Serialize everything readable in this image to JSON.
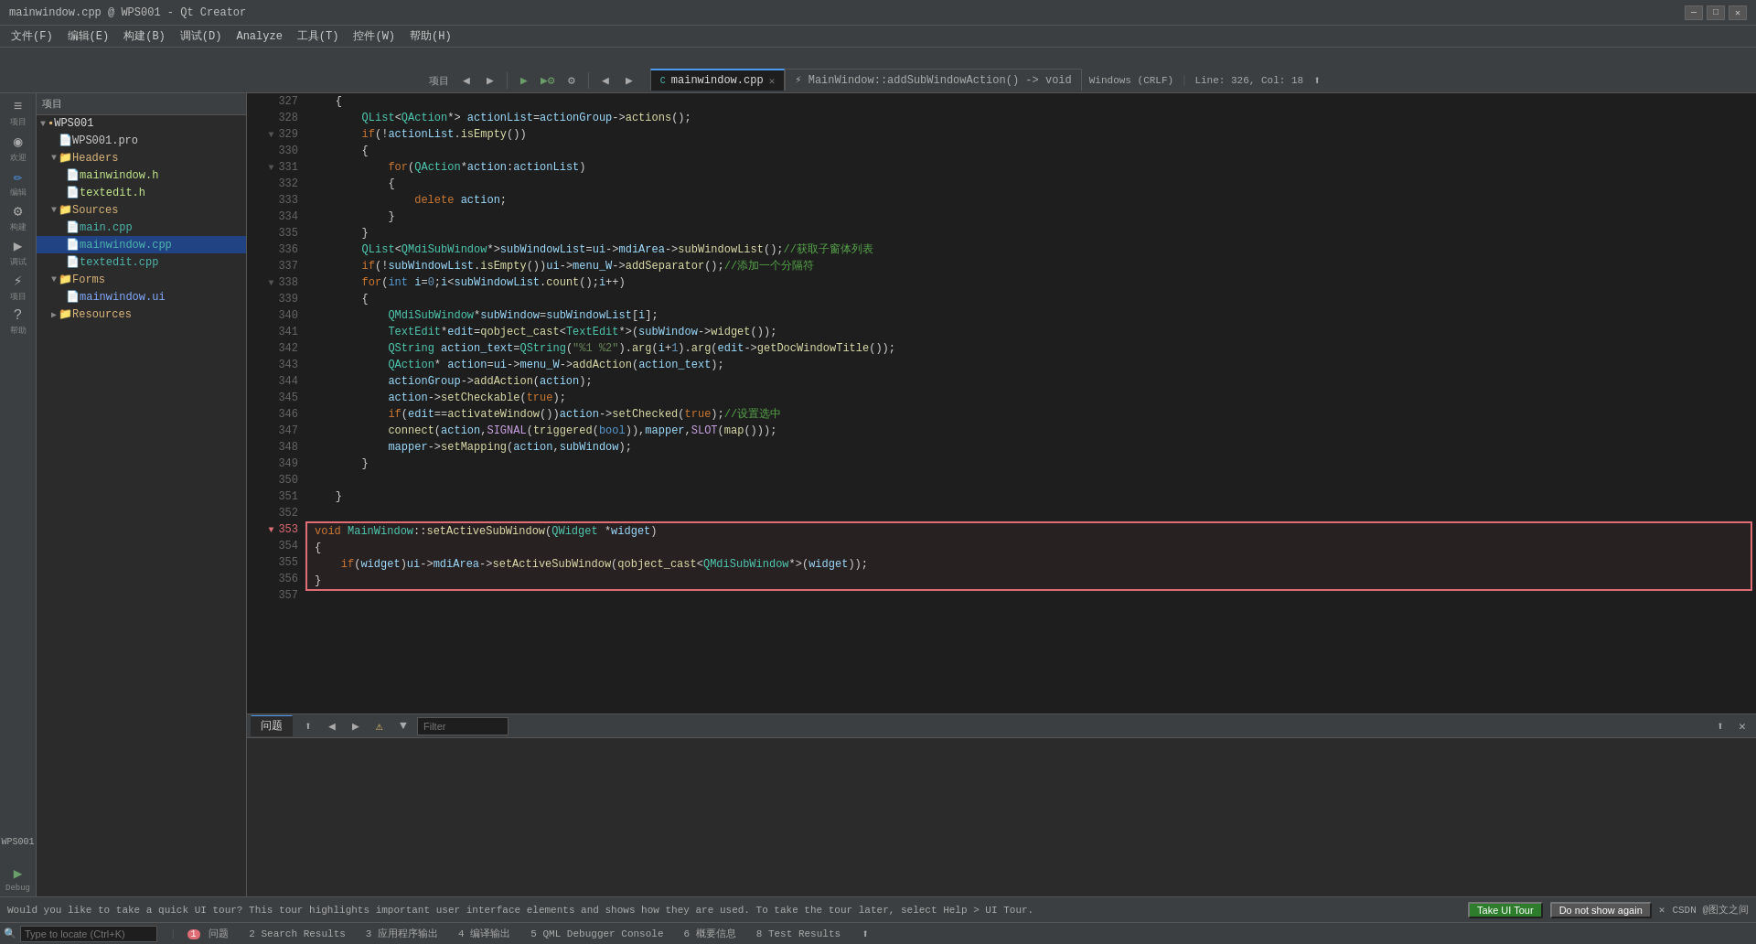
{
  "window": {
    "title": "mainwindow.cpp @ WPS001 - Qt Creator",
    "controls": [
      "—",
      "□",
      "✕"
    ]
  },
  "menubar": {
    "items": [
      "文件(F)",
      "编辑(E)",
      "构建(B)",
      "调试(D)",
      "Analyze",
      "工具(T)",
      "控件(W)",
      "帮助(H)"
    ]
  },
  "toolbar": {
    "project_label": "项目",
    "file_tabs": [
      {
        "name": "mainwindow.cpp",
        "active": true,
        "modified": false
      },
      {
        "name": "MainWindow::addSubWindowAction() -> void",
        "active": false
      }
    ],
    "encoding": "Windows (CRLF)",
    "position": "Line: 326, Col: 18"
  },
  "filetree": {
    "root": "WPS001",
    "items": [
      {
        "label": "WPS001",
        "type": "project",
        "level": 0,
        "expanded": true
      },
      {
        "label": "WPS001.pro",
        "type": "pro",
        "level": 1
      },
      {
        "label": "Headers",
        "type": "folder",
        "level": 1,
        "expanded": true
      },
      {
        "label": "mainwindow.h",
        "type": "h",
        "level": 2
      },
      {
        "label": "textedit.h",
        "type": "h",
        "level": 2
      },
      {
        "label": "Sources",
        "type": "folder",
        "level": 1,
        "expanded": true
      },
      {
        "label": "main.cpp",
        "type": "cpp",
        "level": 2
      },
      {
        "label": "mainwindow.cpp",
        "type": "cpp",
        "level": 2,
        "active": true
      },
      {
        "label": "textedit.cpp",
        "type": "cpp",
        "level": 2
      },
      {
        "label": "Forms",
        "type": "folder",
        "level": 1,
        "expanded": true
      },
      {
        "label": "mainwindow.ui",
        "type": "ui",
        "level": 2
      },
      {
        "label": "Resources",
        "type": "folder",
        "level": 1,
        "expanded": false
      }
    ]
  },
  "sidebar_icons": [
    {
      "icon": "≡",
      "label": "项目",
      "name": "projects"
    },
    {
      "icon": "◉",
      "label": "欢迎",
      "name": "welcome"
    },
    {
      "icon": "✏",
      "label": "编辑",
      "name": "edit",
      "active": true
    },
    {
      "icon": "⚙",
      "label": "构建",
      "name": "build"
    },
    {
      "icon": "▶",
      "label": "调试",
      "name": "debug"
    },
    {
      "icon": "⚡",
      "label": "项目",
      "name": "project2"
    },
    {
      "icon": "?",
      "label": "帮助",
      "name": "help"
    }
  ],
  "code": {
    "lines": [
      {
        "num": 327,
        "fold": false,
        "text": "    {"
      },
      {
        "num": 328,
        "fold": false,
        "text": "        QList<QAction*> actionList=actionGroup->actions();"
      },
      {
        "num": 329,
        "fold": true,
        "text": "        if(!actionList.isEmpty())"
      },
      {
        "num": 330,
        "fold": false,
        "text": "        {"
      },
      {
        "num": 331,
        "fold": true,
        "text": "            for(QAction*action:actionList)"
      },
      {
        "num": 332,
        "fold": false,
        "text": "            {"
      },
      {
        "num": 333,
        "fold": false,
        "text": "                delete action;"
      },
      {
        "num": 334,
        "fold": false,
        "text": "            }"
      },
      {
        "num": 335,
        "fold": false,
        "text": "        }"
      },
      {
        "num": 336,
        "fold": false,
        "text": "        QList<QMdiSubWindow*>subWindowList=ui->mdiArea->subWindowList();//获取子窗体列表"
      },
      {
        "num": 337,
        "fold": false,
        "text": "        if(!subWindowList.isEmpty())ui->menu_W->addSeparator();//添加一个分隔符"
      },
      {
        "num": 338,
        "fold": true,
        "text": "        for(int i=0;i<subWindowList.count();i++)"
      },
      {
        "num": 339,
        "fold": false,
        "text": "        {"
      },
      {
        "num": 340,
        "fold": false,
        "text": "            QMdiSubWindow*subWindow=subWindowList[i];"
      },
      {
        "num": 341,
        "fold": false,
        "text": "            TextEdit*edit=qobject_cast<TextEdit*>(subWindow->widget());"
      },
      {
        "num": 342,
        "fold": false,
        "text": "            QString action_text=QString(\"%1 %2\").arg(i+1).arg(edit->getDocWindowTitle());"
      },
      {
        "num": 343,
        "fold": false,
        "text": "            QAction* action=ui->menu_W->addAction(action_text);"
      },
      {
        "num": 344,
        "fold": false,
        "text": "            actionGroup->addAction(action);"
      },
      {
        "num": 345,
        "fold": false,
        "text": "            action->setCheckable(true);"
      },
      {
        "num": 346,
        "fold": false,
        "text": "            if(edit==activateWindow())action->setChecked(true);//设置选中"
      },
      {
        "num": 347,
        "fold": false,
        "text": "            connect(action,SIGNAL(triggered(bool)),mapper,SLOT(map()));"
      },
      {
        "num": 348,
        "fold": false,
        "text": "            mapper->setMapping(action,subWindow);"
      },
      {
        "num": 349,
        "fold": false,
        "text": "        }"
      },
      {
        "num": 350,
        "fold": false,
        "text": ""
      },
      {
        "num": 351,
        "fold": false,
        "text": "    }"
      },
      {
        "num": 352,
        "fold": false,
        "text": ""
      },
      {
        "num": 353,
        "fold": true,
        "text": "void MainWindow::setActiveSubWindow(QWidget *widget)",
        "highlighted": true
      },
      {
        "num": 354,
        "fold": false,
        "text": "{",
        "highlighted": true
      },
      {
        "num": 355,
        "fold": false,
        "text": "    if(widget)ui->mdiArea->setActiveSubWindow(qobject_cast<QMdiSubWindow*>(widget));",
        "highlighted": true
      },
      {
        "num": 356,
        "fold": false,
        "text": "}",
        "highlighted": true
      },
      {
        "num": 357,
        "fold": false,
        "text": ""
      }
    ]
  },
  "bottom_panel": {
    "tabs": [
      "问题"
    ],
    "toolbar_icons": [
      "⬆",
      "◀",
      "▶",
      "⚠",
      "🔽"
    ],
    "filter_placeholder": "Filter",
    "content": []
  },
  "statusbar": {
    "message": "Would you like to take a quick UI tour? This tour highlights important user interface elements and shows how they are used. To take the tour later, select Help > UI Tour.",
    "take_tour_btn": "Take UI Tour",
    "do_not_show_btn": "Do not show again",
    "close_btn": "✕"
  },
  "bottom_status_tabs": [
    {
      "label": "1 问题",
      "badge": "1",
      "name": "issues"
    },
    {
      "label": "2 Search Results",
      "name": "search-results"
    },
    {
      "label": "3 应用程序输出",
      "name": "app-output"
    },
    {
      "label": "4 编译输出",
      "name": "compile-output"
    },
    {
      "label": "5 QML Debugger Console",
      "name": "qml-debug"
    },
    {
      "label": "6 概要信息",
      "name": "summary"
    },
    {
      "label": "8 Test Results",
      "name": "test-results"
    }
  ],
  "locate_input": {
    "placeholder": "Type to locate (Ctrl+K)"
  }
}
